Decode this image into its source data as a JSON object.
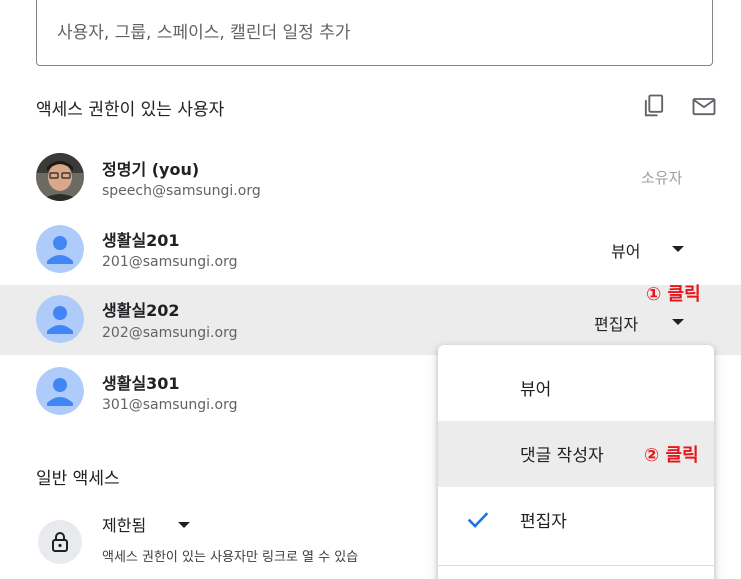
{
  "search": {
    "placeholder": "사용자, 그룹, 스페이스, 캘린더 일정 추가",
    "value": ""
  },
  "access_section": {
    "title": "액세스 권한이 있는 사용자",
    "copy_icon": "copy-links-icon",
    "email_icon": "email-icon"
  },
  "users": [
    {
      "name": "정명기 (you)",
      "email": "speech@samsungi.org",
      "role": "소유자",
      "avatar": "photo"
    },
    {
      "name": "생활실201",
      "email": "201@samsungi.org",
      "role": "뷰어",
      "avatar": "default-person"
    },
    {
      "name": "생활실202",
      "email": "202@samsungi.org",
      "role": "편집자",
      "avatar": "default-person"
    },
    {
      "name": "생활실301",
      "email": "301@samsungi.org",
      "role": "",
      "avatar": "default-person"
    }
  ],
  "annotations": {
    "step1": "① 클릭",
    "step2": "② 클릭"
  },
  "role_menu": {
    "items": [
      {
        "label": "뷰어",
        "selected": false
      },
      {
        "label": "댓글 작성자",
        "selected": false
      },
      {
        "label": "편집자",
        "selected": true
      }
    ]
  },
  "general_access": {
    "title": "일반 액세스",
    "role": "제한됨",
    "description": "액세스 권한이 있는 사용자만 링크로 열 수 있습",
    "icon": "lock-icon"
  },
  "colors": {
    "accent": "#1a73e8",
    "annotation": "#e8151b",
    "avatar_bg": "#aecbfa",
    "avatar_fg": "#4285f4",
    "highlight": "#ececec"
  }
}
